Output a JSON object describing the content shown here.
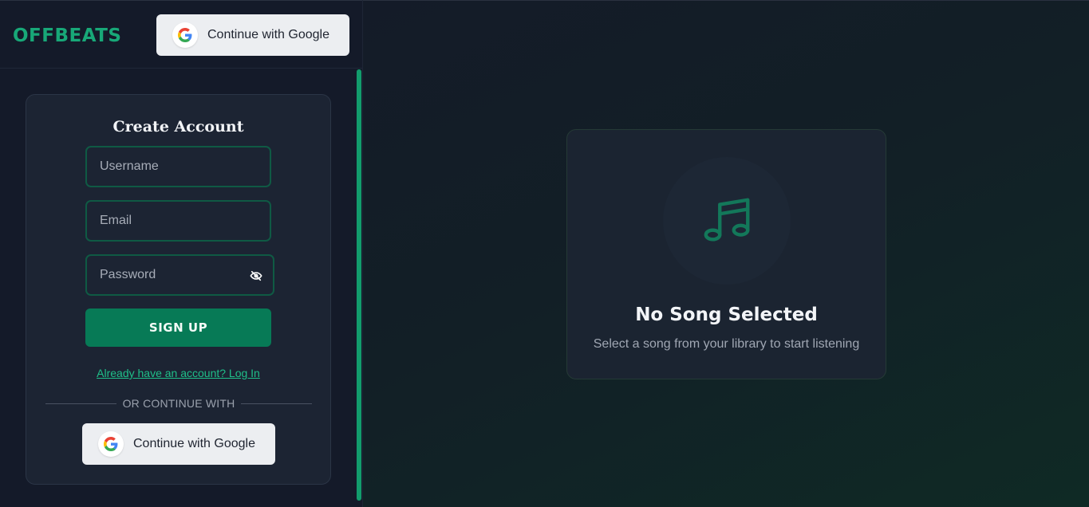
{
  "brand": {
    "name": "OFFBEATS",
    "accent": "#18a878"
  },
  "header": {
    "google_label": "Continue with Google"
  },
  "signup_form": {
    "title": "Create Account",
    "username_placeholder": "Username",
    "email_placeholder": "Email",
    "password_placeholder": "Password",
    "password_toggle_icon": "eye-off-icon",
    "submit_label": "SIGN UP",
    "login_link": "Already have an account? Log In",
    "divider_text": "OR CONTINUE WITH",
    "google_label": "Continue with Google"
  },
  "player": {
    "icon": "music-note-icon",
    "empty_title": "No Song Selected",
    "empty_subtitle": "Select a song from your library to start listening"
  }
}
